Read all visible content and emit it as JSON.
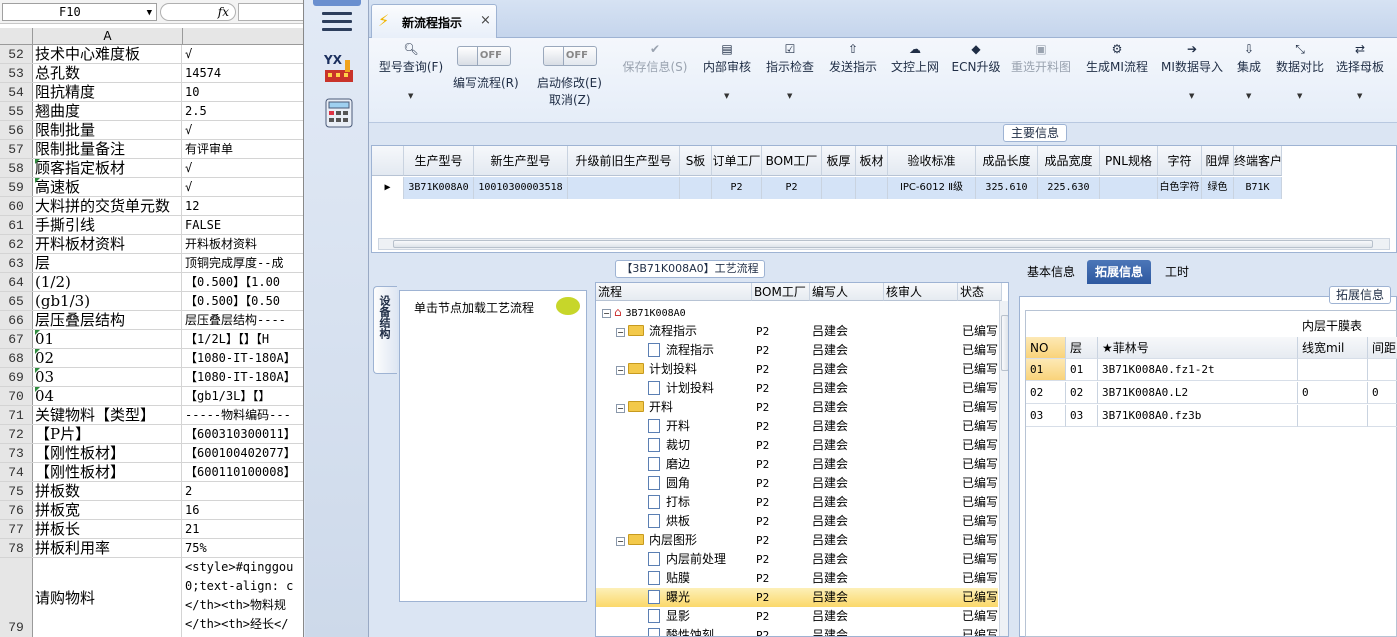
{
  "spreadsheet": {
    "cell_ref": "F10",
    "fx_label": "fx",
    "column_label": "A",
    "rows": [
      {
        "n": "52",
        "a": "技术中心难度板",
        "b": "√"
      },
      {
        "n": "53",
        "a": "总孔数",
        "b": "14574"
      },
      {
        "n": "54",
        "a": "阻抗精度",
        "b": "10"
      },
      {
        "n": "55",
        "a": "翘曲度",
        "b": "2.5"
      },
      {
        "n": "56",
        "a": "限制批量",
        "b": "√"
      },
      {
        "n": "57",
        "a": "限制批量备注",
        "b": "有评审单"
      },
      {
        "n": "58",
        "a": "顾客指定板材",
        "b": "√"
      },
      {
        "n": "59",
        "a": "高速板",
        "b": "√"
      },
      {
        "n": "60",
        "a": "大料拼的交货单元数",
        "b": "12"
      },
      {
        "n": "61",
        "a": "手撕引线",
        "b": "FALSE"
      },
      {
        "n": "62",
        "a": "开料板材资料",
        "b": "开料板材资料"
      },
      {
        "n": "63",
        "a": "层",
        "b": "顶铜完成厚度--成"
      },
      {
        "n": "64",
        "a": "(1/2)",
        "b": "【0.500】【1.00"
      },
      {
        "n": "65",
        "a": "(gb1/3)",
        "b": "【0.500】【0.50"
      },
      {
        "n": "66",
        "a": "层压叠层结构",
        "b": "层压叠层结构----"
      },
      {
        "n": "67",
        "a": "01",
        "b": "【1/2L】【】【H"
      },
      {
        "n": "68",
        "a": "02",
        "b": "【1080-IT-180A】"
      },
      {
        "n": "69",
        "a": "03",
        "b": "【1080-IT-180A】"
      },
      {
        "n": "70",
        "a": "04",
        "b": "【gb1/3L】【】"
      },
      {
        "n": "71",
        "a": "关键物料【类型】",
        "b": "-----物料编码---"
      },
      {
        "n": "72",
        "a": "【P片】",
        "b": "【600310300011】"
      },
      {
        "n": "73",
        "a": "【刚性板材】",
        "b": "【600100402077】"
      },
      {
        "n": "74",
        "a": "【刚性板材】",
        "b": "【600110100008】"
      },
      {
        "n": "75",
        "a": "拼板数",
        "b": "2"
      },
      {
        "n": "76",
        "a": "拼板宽",
        "b": "16"
      },
      {
        "n": "77",
        "a": "拼板长",
        "b": "21"
      },
      {
        "n": "78",
        "a": "拼板利用率",
        "b": "75%"
      }
    ],
    "row79": {
      "n": "79",
      "a": "请购物料",
      "lines": [
        "<style>#qinggou",
        "0;text-align: c",
        "</th><th>物料规",
        "</th><th>经长</"
      ]
    }
  },
  "strip": {
    "logo_text": "YX"
  },
  "tab": {
    "title": "新流程指示",
    "close": "×"
  },
  "toolbar": {
    "query": "型号查询(F)",
    "write_flow": "编写流程(R)",
    "start_modify_1": "启动修改(E)",
    "start_modify_2": "取消(Z)",
    "toggle_off": "OFF",
    "save": "保存信息(S)",
    "internal_review": "内部审核",
    "guide_check": "指示检查",
    "send_guide": "发送指示",
    "upload": "文控上网",
    "ecn": "ECN升级",
    "reselect": "重选开料图",
    "gen_mi": "生成MI流程",
    "mi_import": "MI数据导入",
    "integrate": "集成",
    "compare": "数据对比",
    "select_mother": "选择母板"
  },
  "main_info": {
    "title": "主要信息",
    "headers": [
      "生产型号",
      "新生产型号",
      "升级前旧生产型号",
      "S板",
      "订单工厂",
      "BOM工厂",
      "板厚",
      "板材",
      "验收标准",
      "成品长度",
      "成品宽度",
      "PNL规格",
      "字符",
      "阻焊",
      "终端客户"
    ],
    "row": [
      "3B71K008A0",
      "10010300003518",
      "",
      "",
      "P2",
      "P2",
      "",
      "",
      "IPC-6012 Ⅱ级",
      "325.610",
      "225.630",
      "",
      "白色字符",
      "绿色",
      "B71K"
    ]
  },
  "craft": {
    "title": "【3B71K008A0】工艺流程",
    "vtab": "设备结构",
    "node_hint": "单击节点加载工艺流程",
    "headers": [
      "流程",
      "BOM工厂",
      "编写人",
      "核审人",
      "状态"
    ],
    "root": "3B71K008A0",
    "rows": [
      {
        "name": "流程指示",
        "type": "folder",
        "level": 1,
        "p": "P2",
        "author": "吕建会",
        "status": "已编写"
      },
      {
        "name": "流程指示",
        "type": "doc",
        "level": 2,
        "p": "P2",
        "author": "吕建会",
        "status": "已编写"
      },
      {
        "name": "计划投料",
        "type": "folder",
        "level": 1,
        "p": "P2",
        "author": "吕建会",
        "status": "已编写"
      },
      {
        "name": "计划投料",
        "type": "doc",
        "level": 2,
        "p": "P2",
        "author": "吕建会",
        "status": "已编写"
      },
      {
        "name": "开料",
        "type": "folder",
        "level": 1,
        "p": "P2",
        "author": "吕建会",
        "status": "已编写"
      },
      {
        "name": "开料",
        "type": "doc",
        "level": 2,
        "p": "P2",
        "author": "吕建会",
        "status": "已编写"
      },
      {
        "name": "裁切",
        "type": "doc",
        "level": 2,
        "p": "P2",
        "author": "吕建会",
        "status": "已编写"
      },
      {
        "name": "磨边",
        "type": "doc",
        "level": 2,
        "p": "P2",
        "author": "吕建会",
        "status": "已编写"
      },
      {
        "name": "圆角",
        "type": "doc",
        "level": 2,
        "p": "P2",
        "author": "吕建会",
        "status": "已编写"
      },
      {
        "name": "打标",
        "type": "doc",
        "level": 2,
        "p": "P2",
        "author": "吕建会",
        "status": "已编写"
      },
      {
        "name": "烘板",
        "type": "doc",
        "level": 2,
        "p": "P2",
        "author": "吕建会",
        "status": "已编写"
      },
      {
        "name": "内层图形",
        "type": "folder",
        "level": 1,
        "p": "P2",
        "author": "吕建会",
        "status": "已编写"
      },
      {
        "name": "内层前处理",
        "type": "doc",
        "level": 2,
        "p": "P2",
        "author": "吕建会",
        "status": "已编写"
      },
      {
        "name": "贴膜",
        "type": "doc",
        "level": 2,
        "p": "P2",
        "author": "吕建会",
        "status": "已编写"
      },
      {
        "name": "曝光",
        "type": "doc",
        "level": 2,
        "p": "P2",
        "author": "吕建会",
        "status": "已编写",
        "selected": true
      },
      {
        "name": "显影",
        "type": "doc",
        "level": 2,
        "p": "P2",
        "author": "吕建会",
        "status": "已编写"
      },
      {
        "name": "酸性蚀刻",
        "type": "doc",
        "level": 2,
        "p": "P2",
        "author": "吕建会",
        "status": "已编写"
      }
    ]
  },
  "right": {
    "tabs": [
      "基本信息",
      "拓展信息",
      "工时"
    ],
    "panel_title": "拓展信息",
    "grid_title": "内层干膜表",
    "headers": [
      "NO",
      "层",
      "★菲林号",
      "线宽mil",
      "间距"
    ],
    "rows": [
      [
        "01",
        "01",
        "3B71K008A0.fz1-2t",
        "",
        ""
      ],
      [
        "02",
        "02",
        "3B71K008A0.L2",
        "0",
        "0"
      ],
      [
        "03",
        "03",
        "3B71K008A0.fz3b",
        "",
        ""
      ]
    ]
  }
}
